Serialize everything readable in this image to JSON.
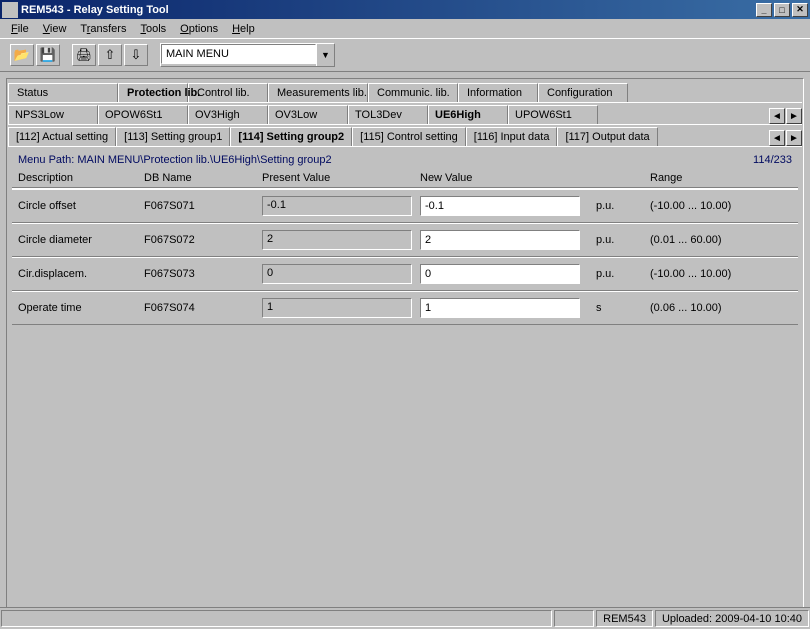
{
  "title": "REM543 - Relay Setting Tool",
  "menu": {
    "file": "File",
    "view": "View",
    "transfers": "Transfers",
    "tools": "Tools",
    "options": "Options",
    "help": "Help"
  },
  "dropdown_value": "MAIN MENU",
  "tabs1": {
    "items": [
      "Status",
      "Protection lib.",
      "Control lib.",
      "Measurements lib.",
      "Communic. lib.",
      "Information",
      "Configuration"
    ],
    "selected": 1
  },
  "tabs2": {
    "items": [
      "NPS3Low",
      "OPOW6St1",
      "OV3High",
      "OV3Low",
      "TOL3Dev",
      "UE6High",
      "UPOW6St1"
    ],
    "selected": 5
  },
  "tabs3": {
    "items": [
      "[112] Actual setting",
      "[113] Setting group1",
      "[114] Setting group2",
      "[115] Control setting",
      "[116] Input data",
      "[117] Output data"
    ],
    "selected": 2
  },
  "menu_path": "Menu Path: MAIN MENU\\Protection lib.\\UE6High\\Setting group2",
  "counter": "114/233",
  "headers": {
    "desc": "Description",
    "db": "DB Name",
    "pv": "Present Value",
    "nv": "New Value",
    "range": "Range"
  },
  "rows": [
    {
      "desc": "Circle offset",
      "db": "F067S071",
      "pv": "-0.1",
      "nv": "-0.1",
      "unit": "p.u.",
      "range": "(-10.00 ... 10.00)"
    },
    {
      "desc": "Circle diameter",
      "db": "F067S072",
      "pv": "2",
      "nv": "2",
      "unit": "p.u.",
      "range": "(0.01 ... 60.00)"
    },
    {
      "desc": "Cir.displacem.",
      "db": "F067S073",
      "pv": "0",
      "nv": "0",
      "unit": "p.u.",
      "range": "(-10.00 ... 10.00)"
    },
    {
      "desc": "Operate time",
      "db": "F067S074",
      "pv": "1",
      "nv": "1",
      "unit": "s",
      "range": "(0.06 ... 10.00)"
    }
  ],
  "status": {
    "device": "REM543",
    "uploaded": "Uploaded: 2009-04-10 10:40"
  }
}
